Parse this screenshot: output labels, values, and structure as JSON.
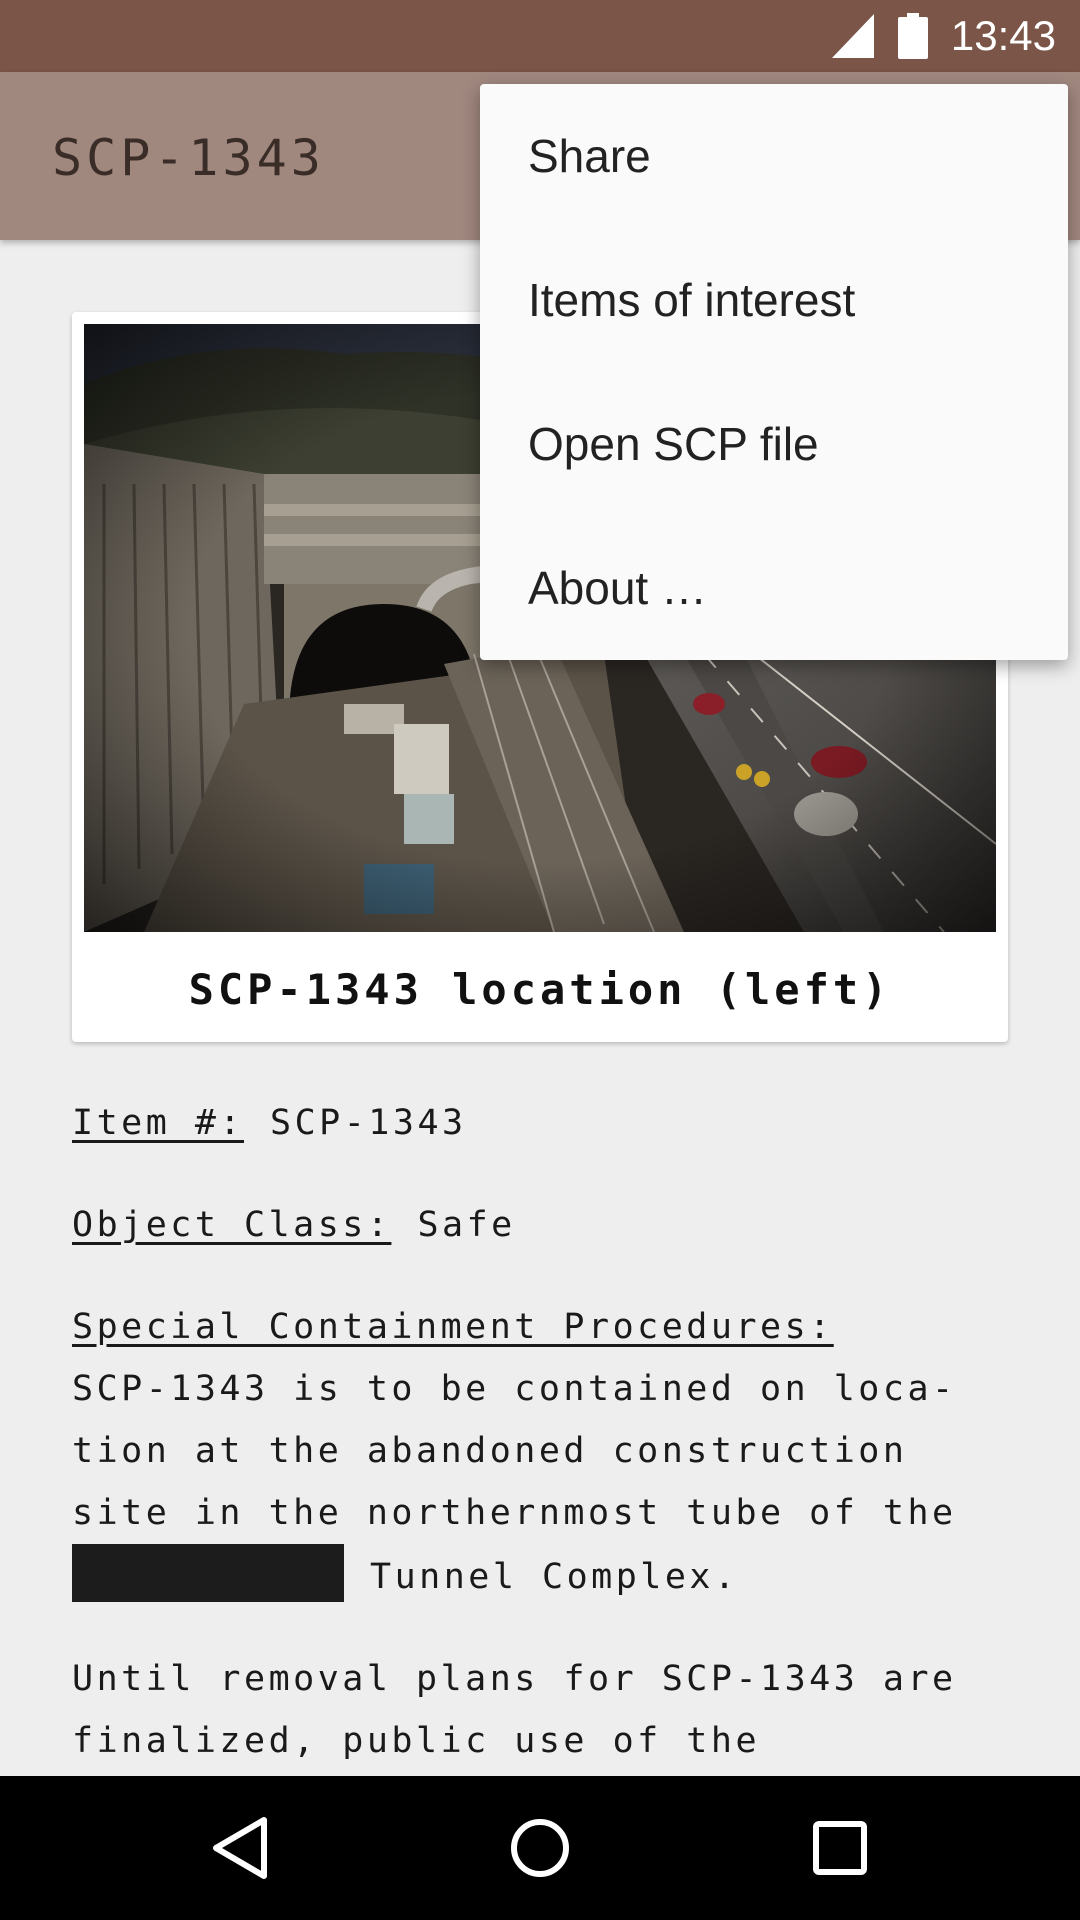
{
  "status_bar": {
    "time": "13:43",
    "signal_icon": "signal-icon",
    "battery_icon": "battery-icon",
    "color": "#7a5548"
  },
  "app_bar": {
    "title": "SCP-1343",
    "color": "#a1887f"
  },
  "photo_card": {
    "caption": "SCP-1343 location (left)",
    "image": "tunnel-construction-photo"
  },
  "document": {
    "item_label": "Item #:",
    "item_value": "SCP-1343",
    "class_label": "Object Class:",
    "class_value": "Safe",
    "procedures_label": "Special Containment Procedures:",
    "procedures_text_before": "SCP-1343 is to be contained on loca-tion at the abandoned construction site in the northernmost tube of the",
    "procedures_text_after": "Tunnel Complex.",
    "next_paragraph": "Until removal plans for SCP-1343 are finalized, public use of the"
  },
  "overflow_menu": {
    "items": [
      {
        "label": "Share"
      },
      {
        "label": "Items of interest"
      },
      {
        "label": "Open SCP file"
      },
      {
        "label": "About …"
      }
    ]
  },
  "nav_bar": {
    "back_icon": "back-icon",
    "home_icon": "home-icon",
    "recents_icon": "recents-icon"
  }
}
